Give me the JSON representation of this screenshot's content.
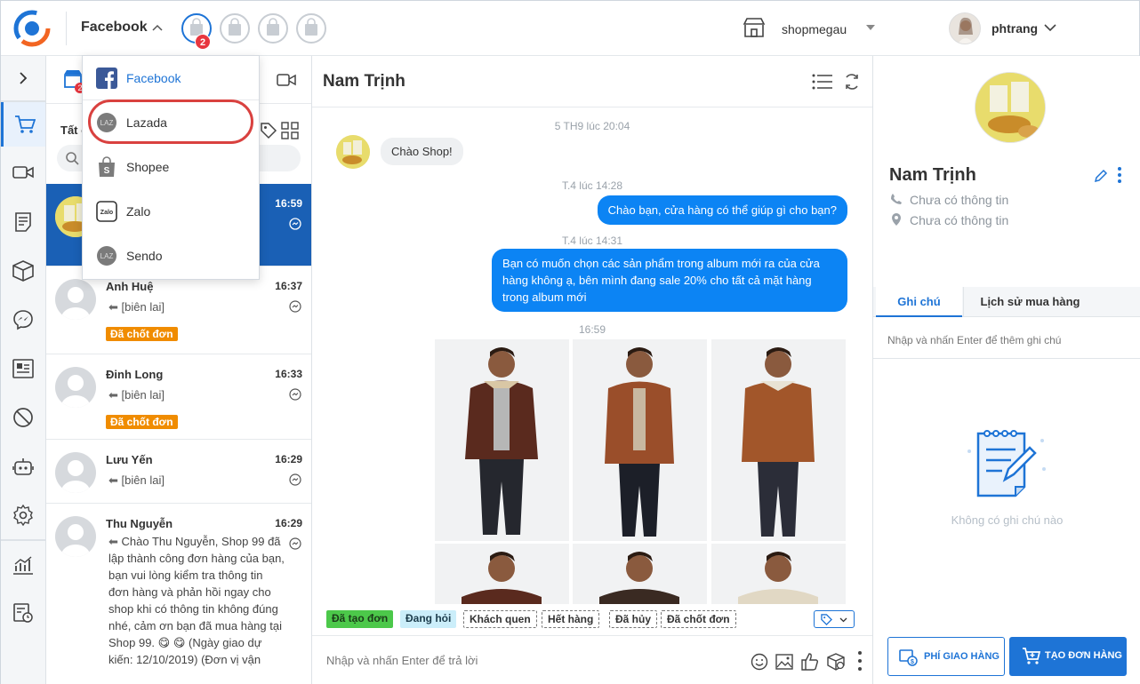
{
  "topbar": {
    "channel": "Facebook",
    "shop_badge": "2",
    "store_name": "shopmegau",
    "user_name": "phtrang"
  },
  "dropdown": {
    "items": [
      {
        "label": "Facebook",
        "icon": "facebook-icon"
      },
      {
        "label": "Lazada",
        "icon": "lazada-icon"
      },
      {
        "label": "Shopee",
        "icon": "shopee-icon"
      },
      {
        "label": "Zalo",
        "icon": "zalo-icon"
      },
      {
        "label": "Sendo",
        "icon": "sendo-icon"
      }
    ]
  },
  "conversation_list": {
    "filter_label": "Tất c",
    "tab_badge": "2",
    "items": [
      {
        "name": "",
        "time": "16:59",
        "preview": "",
        "tag": ""
      },
      {
        "name": "Anh Huệ",
        "time": "16:37",
        "preview": "[biên lai]",
        "tag": "Đã chốt đơn"
      },
      {
        "name": "Đinh Long",
        "time": "16:33",
        "preview": "[biên lai]",
        "tag": "Đã chốt đơn"
      },
      {
        "name": "Lưu Yến",
        "time": "16:29",
        "preview": "[biên lai]",
        "tag": ""
      },
      {
        "name": "Thu Nguyễn",
        "time": "16:29",
        "preview": "Chào Thu Nguyễn, Shop 99 đã lập thành công đơn hàng của bạn, bạn vui lòng kiểm tra thông tin đơn hàng và phản hồi ngay cho shop khi có thông tin không đúng nhé, cảm ơn bạn đã mua hàng tại Shop 99. 😋 😋 (Ngày giao dự kiến: 12/10/2019) (Đơn vị vận",
        "tag": ""
      }
    ]
  },
  "chat": {
    "title": "Nam Trịnh",
    "messages": [
      {
        "timestamp": "5 TH9 lúc 20:04",
        "text": "Chào Shop!",
        "direction": "in"
      },
      {
        "timestamp": "T.4 lúc 14:28",
        "text": "Chào bạn, cửa hàng có thể giúp gì cho bạn?",
        "direction": "out"
      },
      {
        "timestamp": "T.4 lúc 14:31",
        "text": "Bạn có muốn chọn các sản phẩm trong album mới ra của cửa hàng không ạ, bên mình đang sale 20% cho tất cả mặt hàng trong album mới",
        "direction": "out"
      },
      {
        "timestamp": "16:59",
        "text": "",
        "direction": "out"
      }
    ],
    "tags": [
      "Đã tạo đơn",
      "Đang hỏi",
      "Khách quen",
      "Hết hàng",
      "Đã hủy",
      "Đã chốt đơn"
    ],
    "composer_placeholder": "Nhập và nhấn Enter để trả lời"
  },
  "customer": {
    "name": "Nam Trịnh",
    "phone": "Chưa có thông tin",
    "address": "Chưa có thông tin",
    "tabs": [
      "Ghi chú",
      "Lịch sử mua hàng"
    ],
    "note_placeholder": "Nhập và nhấn Enter để thêm ghi chú",
    "empty_note": "Không có ghi chú nào",
    "ship_fee_button": "PHÍ GIAO HÀNG",
    "create_order_button": "TẠO ĐƠN HÀNG"
  },
  "colors": {
    "accent": "#1e74d6",
    "bubble_out": "#0c84f4",
    "selected_row": "#1a60b5",
    "tag_orange": "#f08c00",
    "highlight": "#d9413f"
  }
}
